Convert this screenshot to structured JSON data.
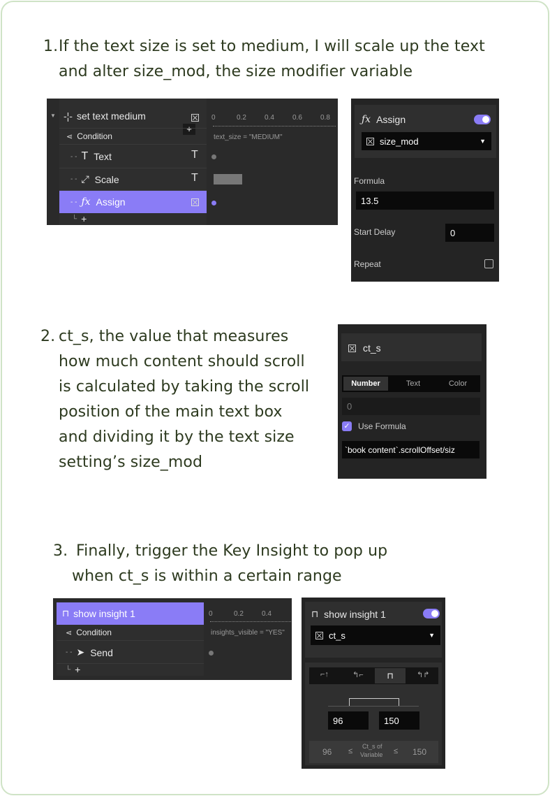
{
  "step1": {
    "number": "1.",
    "lines": [
      "If the text size is set to medium, I will scale up the text",
      "and alter size_mod, the size modifier variable"
    ]
  },
  "timeline1": {
    "title": "set text medium",
    "condition_label": "Condition",
    "items": [
      "Text",
      "Scale",
      "Assign"
    ],
    "add_label": "+",
    "ruler": [
      "0",
      "0.2",
      "0.4",
      "0.6",
      "0.8"
    ],
    "condition_text": "text_size = \"MEDIUM\""
  },
  "assign_panel": {
    "title": "Assign",
    "variable": "size_mod",
    "formula_label": "Formula",
    "formula_value": "13.5",
    "start_delay_label": "Start Delay",
    "start_delay_value": "0",
    "repeat_label": "Repeat"
  },
  "step2": {
    "number": "2.",
    "lines": [
      "ct_s, the value that measures",
      "how much content should scroll",
      "is calculated by taking the scroll",
      "position of the main text box",
      "and dividing it by the text size",
      "setting’s size_mod"
    ]
  },
  "variable_panel": {
    "name": "ct_s",
    "tabs": [
      "Number",
      "Text",
      "Color"
    ],
    "value": "0",
    "use_formula_label": "Use Formula",
    "formula": "`book content`.scrollOffset/siz"
  },
  "step3": {
    "number": "3.",
    "lines": [
      "Finally, trigger the Key Insight to pop up",
      "when ct_s is within a certain range"
    ]
  },
  "timeline2": {
    "title": "show insight 1",
    "condition_label": "Condition",
    "items": [
      "Send"
    ],
    "add_label": "+",
    "ruler": [
      "0",
      "0.2",
      "0.4"
    ],
    "condition_text": "insights_visible = \"YES\""
  },
  "insight_panel": {
    "title": "show insight 1",
    "variable": "ct_s",
    "min_value": "96",
    "max_value": "150",
    "summary_min": "96",
    "summary_le1": "≤",
    "summary_label_1": "Ct_s of",
    "summary_label_2": "Variable",
    "summary_le2": "≤",
    "summary_max": "150"
  },
  "colors": {
    "accent": "#8a7cf6",
    "panel": "#242424",
    "text": "#2d3a1f",
    "border": "#cfe3c6"
  }
}
